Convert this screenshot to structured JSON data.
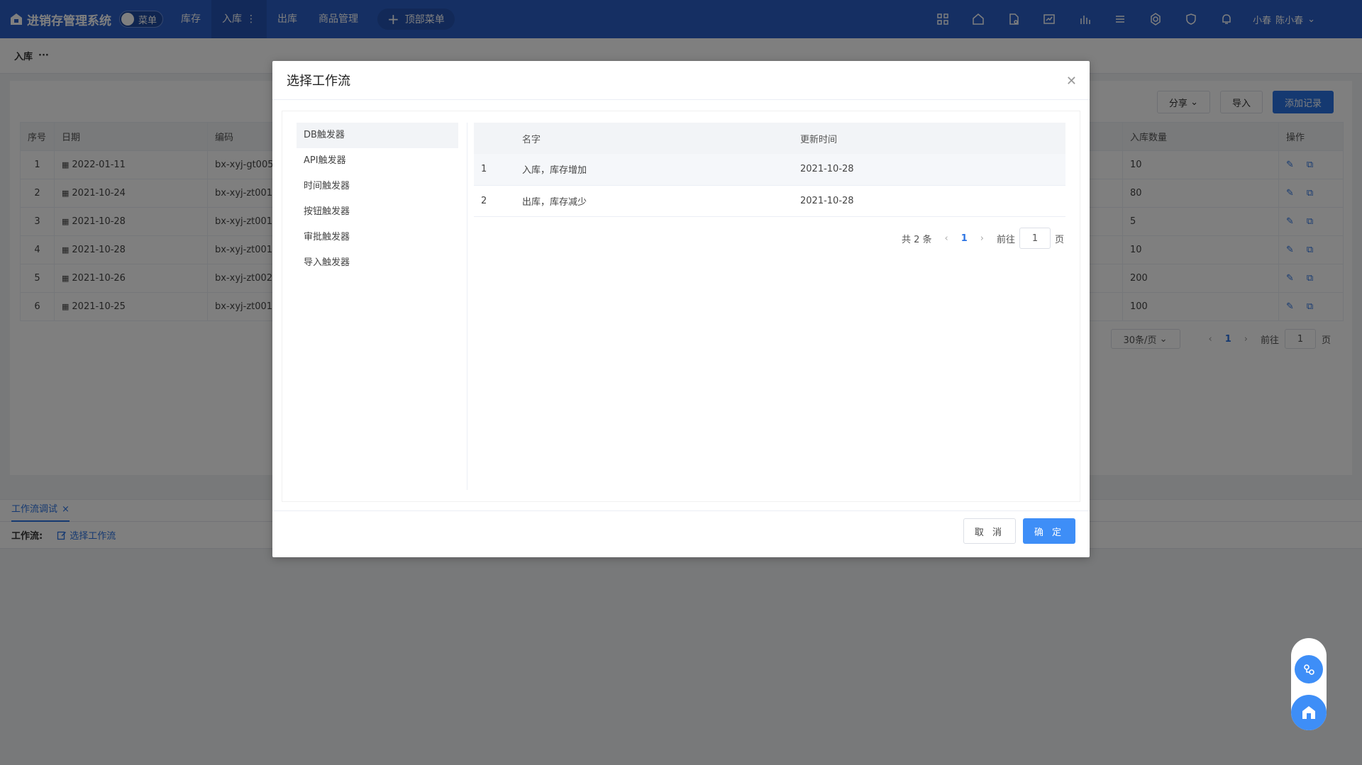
{
  "app": {
    "title": "进销存管理系统",
    "menu_toggle": "菜单",
    "nav": [
      {
        "label": "库存"
      },
      {
        "label": "入库",
        "extra": "⋮"
      },
      {
        "label": "出库"
      },
      {
        "label": "商品管理"
      }
    ],
    "add_menu": "顶部菜单",
    "user_short": "小春",
    "user_name": "陈小春"
  },
  "breadcrumb": {
    "current": "入库",
    "more": "···"
  },
  "toolbar": {
    "share": "分享",
    "import": "导入",
    "add": "添加记录"
  },
  "bg_table": {
    "headers": [
      "序号",
      "日期",
      "编码",
      "入库数量",
      "操作"
    ],
    "rows": [
      {
        "no": "1",
        "date": "2022-01-11",
        "code": "bx-xyj-gt005",
        "qty": "10"
      },
      {
        "no": "2",
        "date": "2021-10-24",
        "code": "bx-xyj-zt001",
        "qty": "80"
      },
      {
        "no": "3",
        "date": "2021-10-28",
        "code": "bx-xyj-zt001",
        "qty": "5"
      },
      {
        "no": "4",
        "date": "2021-10-28",
        "code": "bx-xyj-zt001",
        "qty": "10"
      },
      {
        "no": "5",
        "date": "2021-10-26",
        "code": "bx-xyj-zt002",
        "qty": "200"
      },
      {
        "no": "6",
        "date": "2021-10-25",
        "code": "bx-xyj-zt001",
        "qty": "100"
      }
    ]
  },
  "bg_pager": {
    "page_size": "30条/页",
    "page": "1",
    "goto": "前往",
    "goto_value": "1",
    "page_unit": "页"
  },
  "debug": {
    "tab": "工作流调试",
    "tab_close": "×",
    "label": "工作流:",
    "action": "选择工作流"
  },
  "modal": {
    "title": "选择工作流",
    "triggers": [
      "DB触发器",
      "API触发器",
      "时间触发器",
      "按钮触发器",
      "审批触发器",
      "导入触发器"
    ],
    "table": {
      "headers": [
        "",
        "名字",
        "更新时间"
      ],
      "rows": [
        {
          "no": "1",
          "name": "入库，库存增加",
          "updated": "2021-10-28"
        },
        {
          "no": "2",
          "name": "出库，库存减少",
          "updated": "2021-10-28"
        }
      ]
    },
    "pager": {
      "total": "共 2 条",
      "page": "1",
      "goto": "前往",
      "goto_value": "1",
      "page_unit": "页"
    },
    "cancel": "取 消",
    "confirm": "确 定"
  },
  "colors": {
    "primary": "#2b73e3",
    "topbar": "#2b5fc6",
    "confirm": "#3e8ef7"
  },
  "icons": [
    "grid-icon",
    "home-icon",
    "file-icon",
    "dashboard-icon",
    "chart-icon",
    "layers-icon",
    "settings-icon",
    "shield-icon",
    "bell-icon"
  ]
}
